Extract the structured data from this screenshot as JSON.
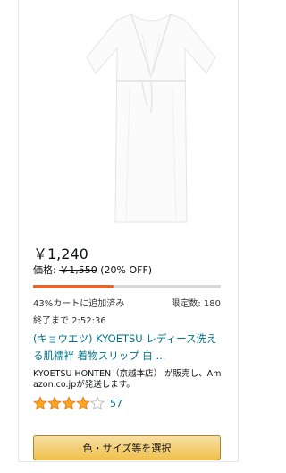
{
  "product": {
    "price": "￥1,240",
    "list_price_label": "価格:",
    "list_price": "￥1,550",
    "discount": "(20% OFF)",
    "deal": {
      "claimed_percent": 43,
      "claimed_text": "43%カートに追加済み",
      "limit_text": "限定数: 180",
      "ends_text": "終了まで 2:52:36"
    },
    "title": "(キョウエツ) KYOETSU レディース洗える肌襦袢 着物スリップ 白 ...",
    "seller_text": "KYOETSU HONTEN（京越本店） が販売し、Amazon.co.jpが発送します。",
    "rating": {
      "stars": 4,
      "max": 5,
      "count": "57"
    },
    "button_label": "色・サイズ等を選択"
  },
  "colors": {
    "price": "#0f1111",
    "progress": "#e0672f",
    "link": "#007185",
    "star": "#ffa41c",
    "button": "#f0c14b"
  },
  "icons": [
    "star-full-icon",
    "star-empty-icon"
  ]
}
